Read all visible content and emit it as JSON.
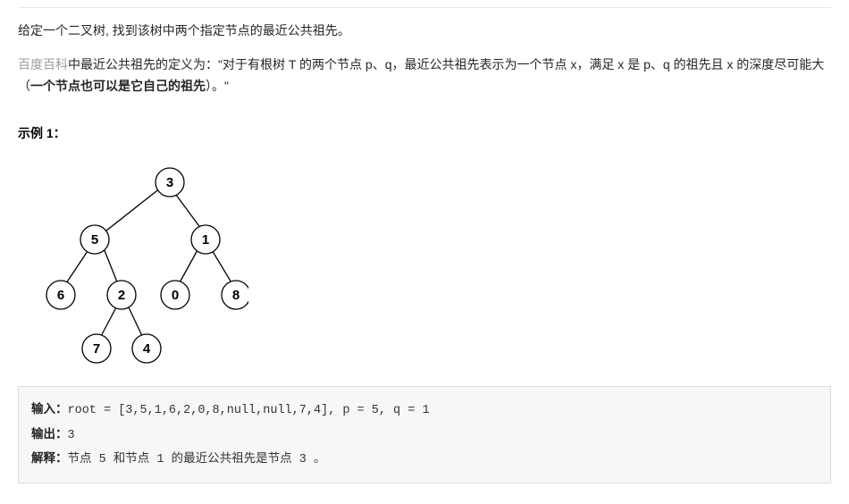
{
  "problem": {
    "intro": "给定一个二叉树, 找到该树中两个指定节点的最近公共祖先。",
    "wiki_link_text": "百度百科",
    "definition_prefix": "中最近公共祖先的定义为：\"对于有根树 T 的两个节点 p、q，最近公共祖先表示为一个节点 x，满足 x 是 p、q 的祖先且 x 的深度尽可能大（",
    "definition_bold": "一个节点也可以是它自己的祖先",
    "definition_suffix": "）。\""
  },
  "example": {
    "heading": "示例 1：",
    "input_label": "输入：",
    "input_value": "root = [3,5,1,6,2,0,8,null,null,7,4], p = 5, q = 1",
    "output_label": "输出：",
    "output_value": "3",
    "explain_label": "解释：",
    "explain_value": "节点 5 和节点 1 的最近公共祖先是节点 3 。"
  },
  "tree": {
    "nodes": {
      "n3": "3",
      "n5": "5",
      "n1": "1",
      "n6": "6",
      "n2": "2",
      "n0": "0",
      "n8": "8",
      "n7": "7",
      "n4": "4"
    }
  }
}
